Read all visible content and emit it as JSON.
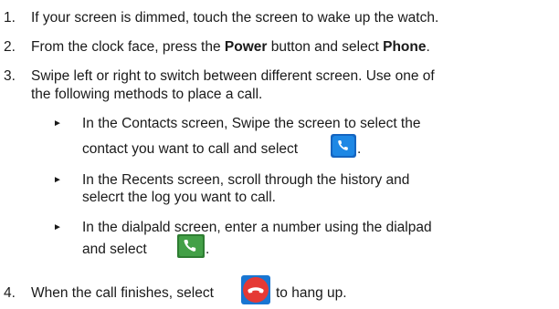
{
  "steps": [
    {
      "number": "1.",
      "text": "If your screen is dimmed, touch the screen to wake up the watch."
    },
    {
      "number": "2.",
      "text_a": "From the clock face, press the ",
      "bold_a": "Power",
      "text_b": " button and select ",
      "bold_b": "Phone",
      "text_c": "."
    },
    {
      "number": "3.",
      "line1": "Swipe left or right to switch between different screen. Use one of",
      "line2": "the following methods to place a call.",
      "bullets": [
        {
          "marker": "►",
          "line1": "In the Contacts screen, Swipe the screen to select the",
          "line2": "contact you want to call and select",
          "end": ".",
          "icon": "contacts-call-icon"
        },
        {
          "marker": "►",
          "line1": "In the Recents screen, scroll through the history and",
          "line2": "selecrt the log you want to call."
        },
        {
          "marker": "►",
          "line1": "In the dialpald screen, enter a number using the dialpad",
          "line2": "and select",
          "end": ".",
          "icon": "dialpad-call-icon"
        }
      ]
    },
    {
      "number": "4.",
      "text_a": "When the call finishes, select",
      "text_b": "to hang up.",
      "icon": "hang-up-icon"
    }
  ],
  "colors": {
    "contacts_icon_bg": "#1565c0",
    "dialpad_icon_bg": "#2e7d32",
    "hangup_icon_bg": "#e53935"
  }
}
